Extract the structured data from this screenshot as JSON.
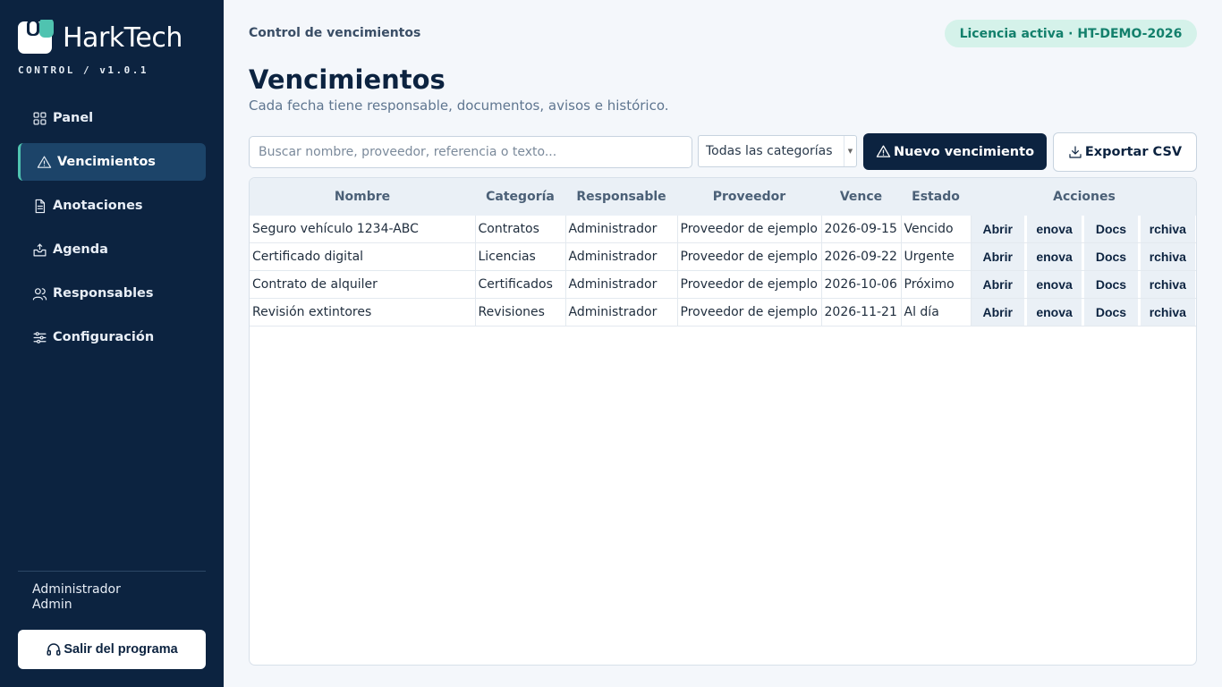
{
  "brand": {
    "name": "HarkTech",
    "sub": "CONTROL / v1.0.1"
  },
  "sidebar": {
    "items": [
      {
        "label": "Panel",
        "icon": "grid-icon"
      },
      {
        "label": "Vencimientos",
        "icon": "warning-icon",
        "active": true
      },
      {
        "label": "Anotaciones",
        "icon": "document-icon"
      },
      {
        "label": "Agenda",
        "icon": "inbox-upload-icon"
      },
      {
        "label": "Responsables",
        "icon": "users-icon"
      },
      {
        "label": "Configuración",
        "icon": "sliders-icon"
      }
    ],
    "user_name": "Administrador",
    "user_role": "Admin",
    "exit_label": "Salir del programa"
  },
  "header": {
    "breadcrumb": "Control de vencimientos",
    "license": "Licencia activa · HT-DEMO-2026",
    "title": "Vencimientos",
    "subtitle": "Cada fecha tiene responsable, documentos, avisos e histórico."
  },
  "toolbar": {
    "search_placeholder": "Buscar nombre, proveedor, referencia o texto...",
    "category_selected": "Todas las categorías",
    "new_label": "Nuevo vencimiento",
    "export_label": "Exportar CSV"
  },
  "table": {
    "columns": [
      "Nombre",
      "Categoría",
      "Responsable",
      "Proveedor",
      "Vence",
      "Estado",
      "Acciones"
    ],
    "action_labels": [
      "Abrir",
      "enova",
      "Docs",
      "rchiva"
    ],
    "rows": [
      [
        "Seguro vehículo 1234-ABC",
        "Contratos",
        "Administrador",
        "Proveedor de ejemplo",
        "2026-09-15",
        "Vencido"
      ],
      [
        "Certificado digital",
        "Licencias",
        "Administrador",
        "Proveedor de ejemplo",
        "2026-09-22",
        "Urgente"
      ],
      [
        "Contrato de alquiler",
        "Certificados",
        "Administrador",
        "Proveedor de ejemplo",
        "2026-10-06",
        "Próximo"
      ],
      [
        "Revisión extintores",
        "Revisiones",
        "Administrador",
        "Proveedor de ejemplo",
        "2026-11-21",
        "Al día"
      ]
    ]
  },
  "colors": {
    "sidebar": "#0c2340",
    "accent": "#4fc3b0",
    "license_bg": "#d5f2ea",
    "license_fg": "#13806c"
  }
}
